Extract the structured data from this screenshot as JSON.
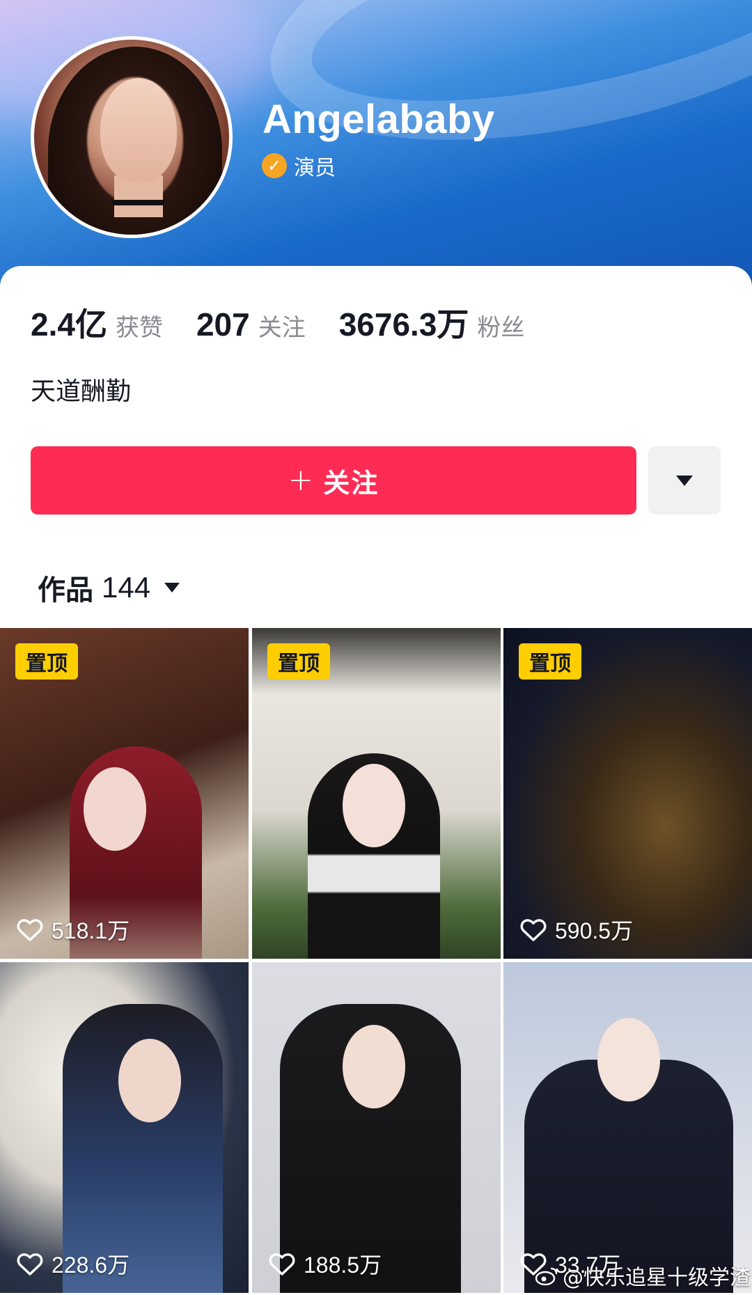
{
  "profile": {
    "username": "Angelababy",
    "verified_label": "演员",
    "bio": "天道酬勤"
  },
  "stats": [
    {
      "value": "2.4亿",
      "label": "获赞"
    },
    {
      "value": "207",
      "label": "关注"
    },
    {
      "value": "3676.3万",
      "label": "粉丝"
    }
  ],
  "actions": {
    "follow_plus": "+",
    "follow_label": "关注"
  },
  "works": {
    "label": "作品",
    "count": "144"
  },
  "videos": [
    {
      "pinned_label": "置顶",
      "likes": "518.1万"
    },
    {
      "pinned_label": "置顶",
      "likes": ""
    },
    {
      "pinned_label": "置顶",
      "likes": "590.5万"
    },
    {
      "pinned_label": "",
      "likes": "228.6万"
    },
    {
      "pinned_label": "",
      "likes": "188.5万"
    },
    {
      "pinned_label": "",
      "likes": "33.7万"
    }
  ],
  "watermark": "@快乐追星十级学渣",
  "colors": {
    "follow_button": "#fe2c55",
    "pin_badge": "#fece00",
    "verify_badge": "#f6a623"
  },
  "icons": [
    "verified-check-icon",
    "caret-down-icon",
    "heart-icon",
    "weibo-icon"
  ]
}
